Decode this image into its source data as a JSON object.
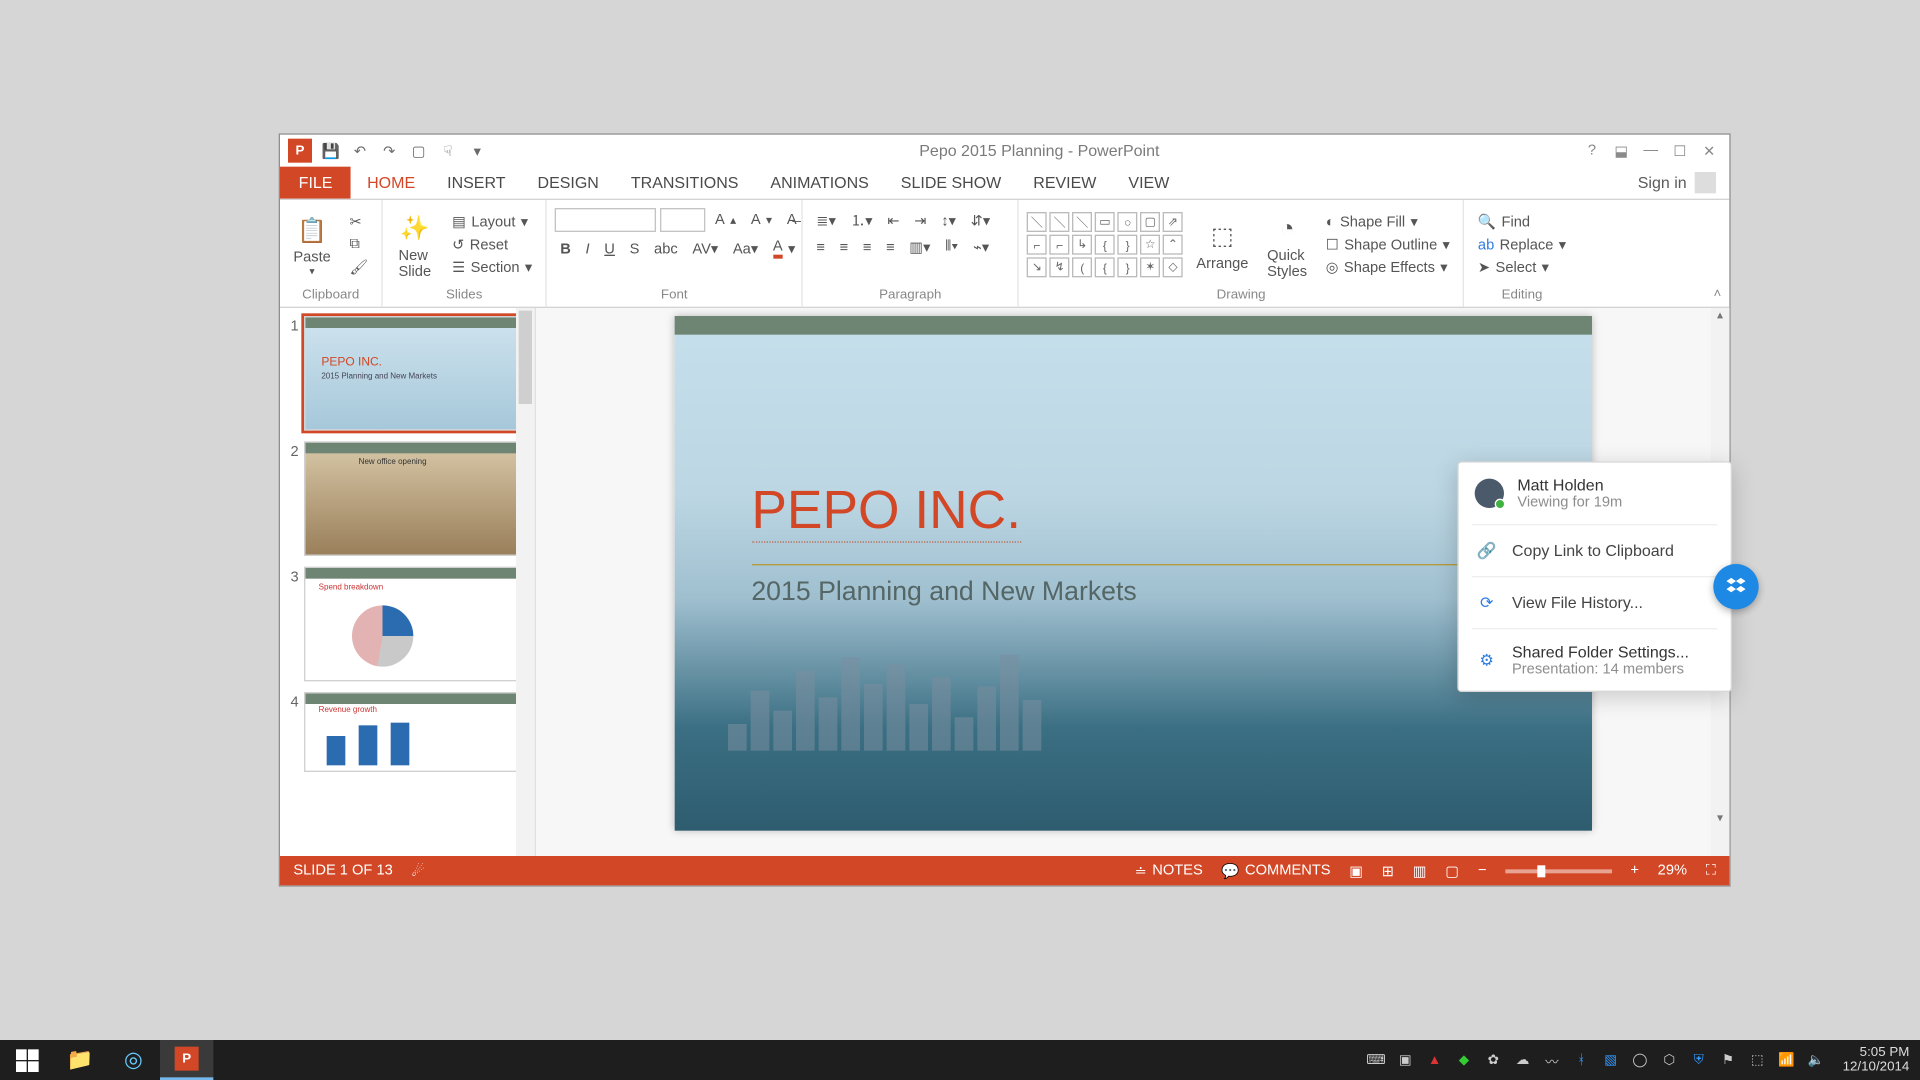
{
  "titlebar": {
    "title": "Pepo 2015 Planning - PowerPoint",
    "signin": "Sign in"
  },
  "tabs": {
    "file": "FILE",
    "home": "HOME",
    "insert": "INSERT",
    "design": "DESIGN",
    "transitions": "TRANSITIONS",
    "animations": "ANIMATIONS",
    "slideshow": "SLIDE SHOW",
    "review": "REVIEW",
    "view": "VIEW"
  },
  "ribbon": {
    "clipboard": {
      "paste": "Paste",
      "label": "Clipboard"
    },
    "slides": {
      "newslide": "New\nSlide",
      "layout": "Layout",
      "reset": "Reset",
      "section": "Section",
      "label": "Slides"
    },
    "font": {
      "label": "Font",
      "bold": "B",
      "italic": "I",
      "underline": "U",
      "strike": "S"
    },
    "paragraph": {
      "label": "Paragraph"
    },
    "drawing": {
      "arrange": "Arrange",
      "quick": "Quick\nStyles",
      "fill": "Shape Fill",
      "outline": "Shape Outline",
      "effects": "Shape Effects",
      "label": "Drawing"
    },
    "editing": {
      "find": "Find",
      "replace": "Replace",
      "select": "Select",
      "label": "Editing"
    }
  },
  "thumbs": [
    {
      "n": "1",
      "title": "PEPO INC.",
      "sub": "2015 Planning and New Markets"
    },
    {
      "n": "2",
      "title": "New office opening",
      "sub": ""
    },
    {
      "n": "3",
      "title": "Spend breakdown",
      "sub": ""
    },
    {
      "n": "4",
      "title": "Revenue growth",
      "sub": ""
    }
  ],
  "slide": {
    "title": "PEPO INC.",
    "subtitle": "2015 Planning and New Markets"
  },
  "status": {
    "slide": "SLIDE 1 OF 13",
    "notes": "NOTES",
    "comments": "COMMENTS",
    "zoom": "29%"
  },
  "dropbox": {
    "viewer_name": "Matt Holden",
    "viewer_sub": "Viewing for 19m",
    "copy": "Copy Link to Clipboard",
    "history": "View File History...",
    "settings": "Shared Folder Settings...",
    "settings_sub": "Presentation: 14 members"
  },
  "taskbar": {
    "time": "5:05 PM",
    "date": "12/10/2014"
  }
}
